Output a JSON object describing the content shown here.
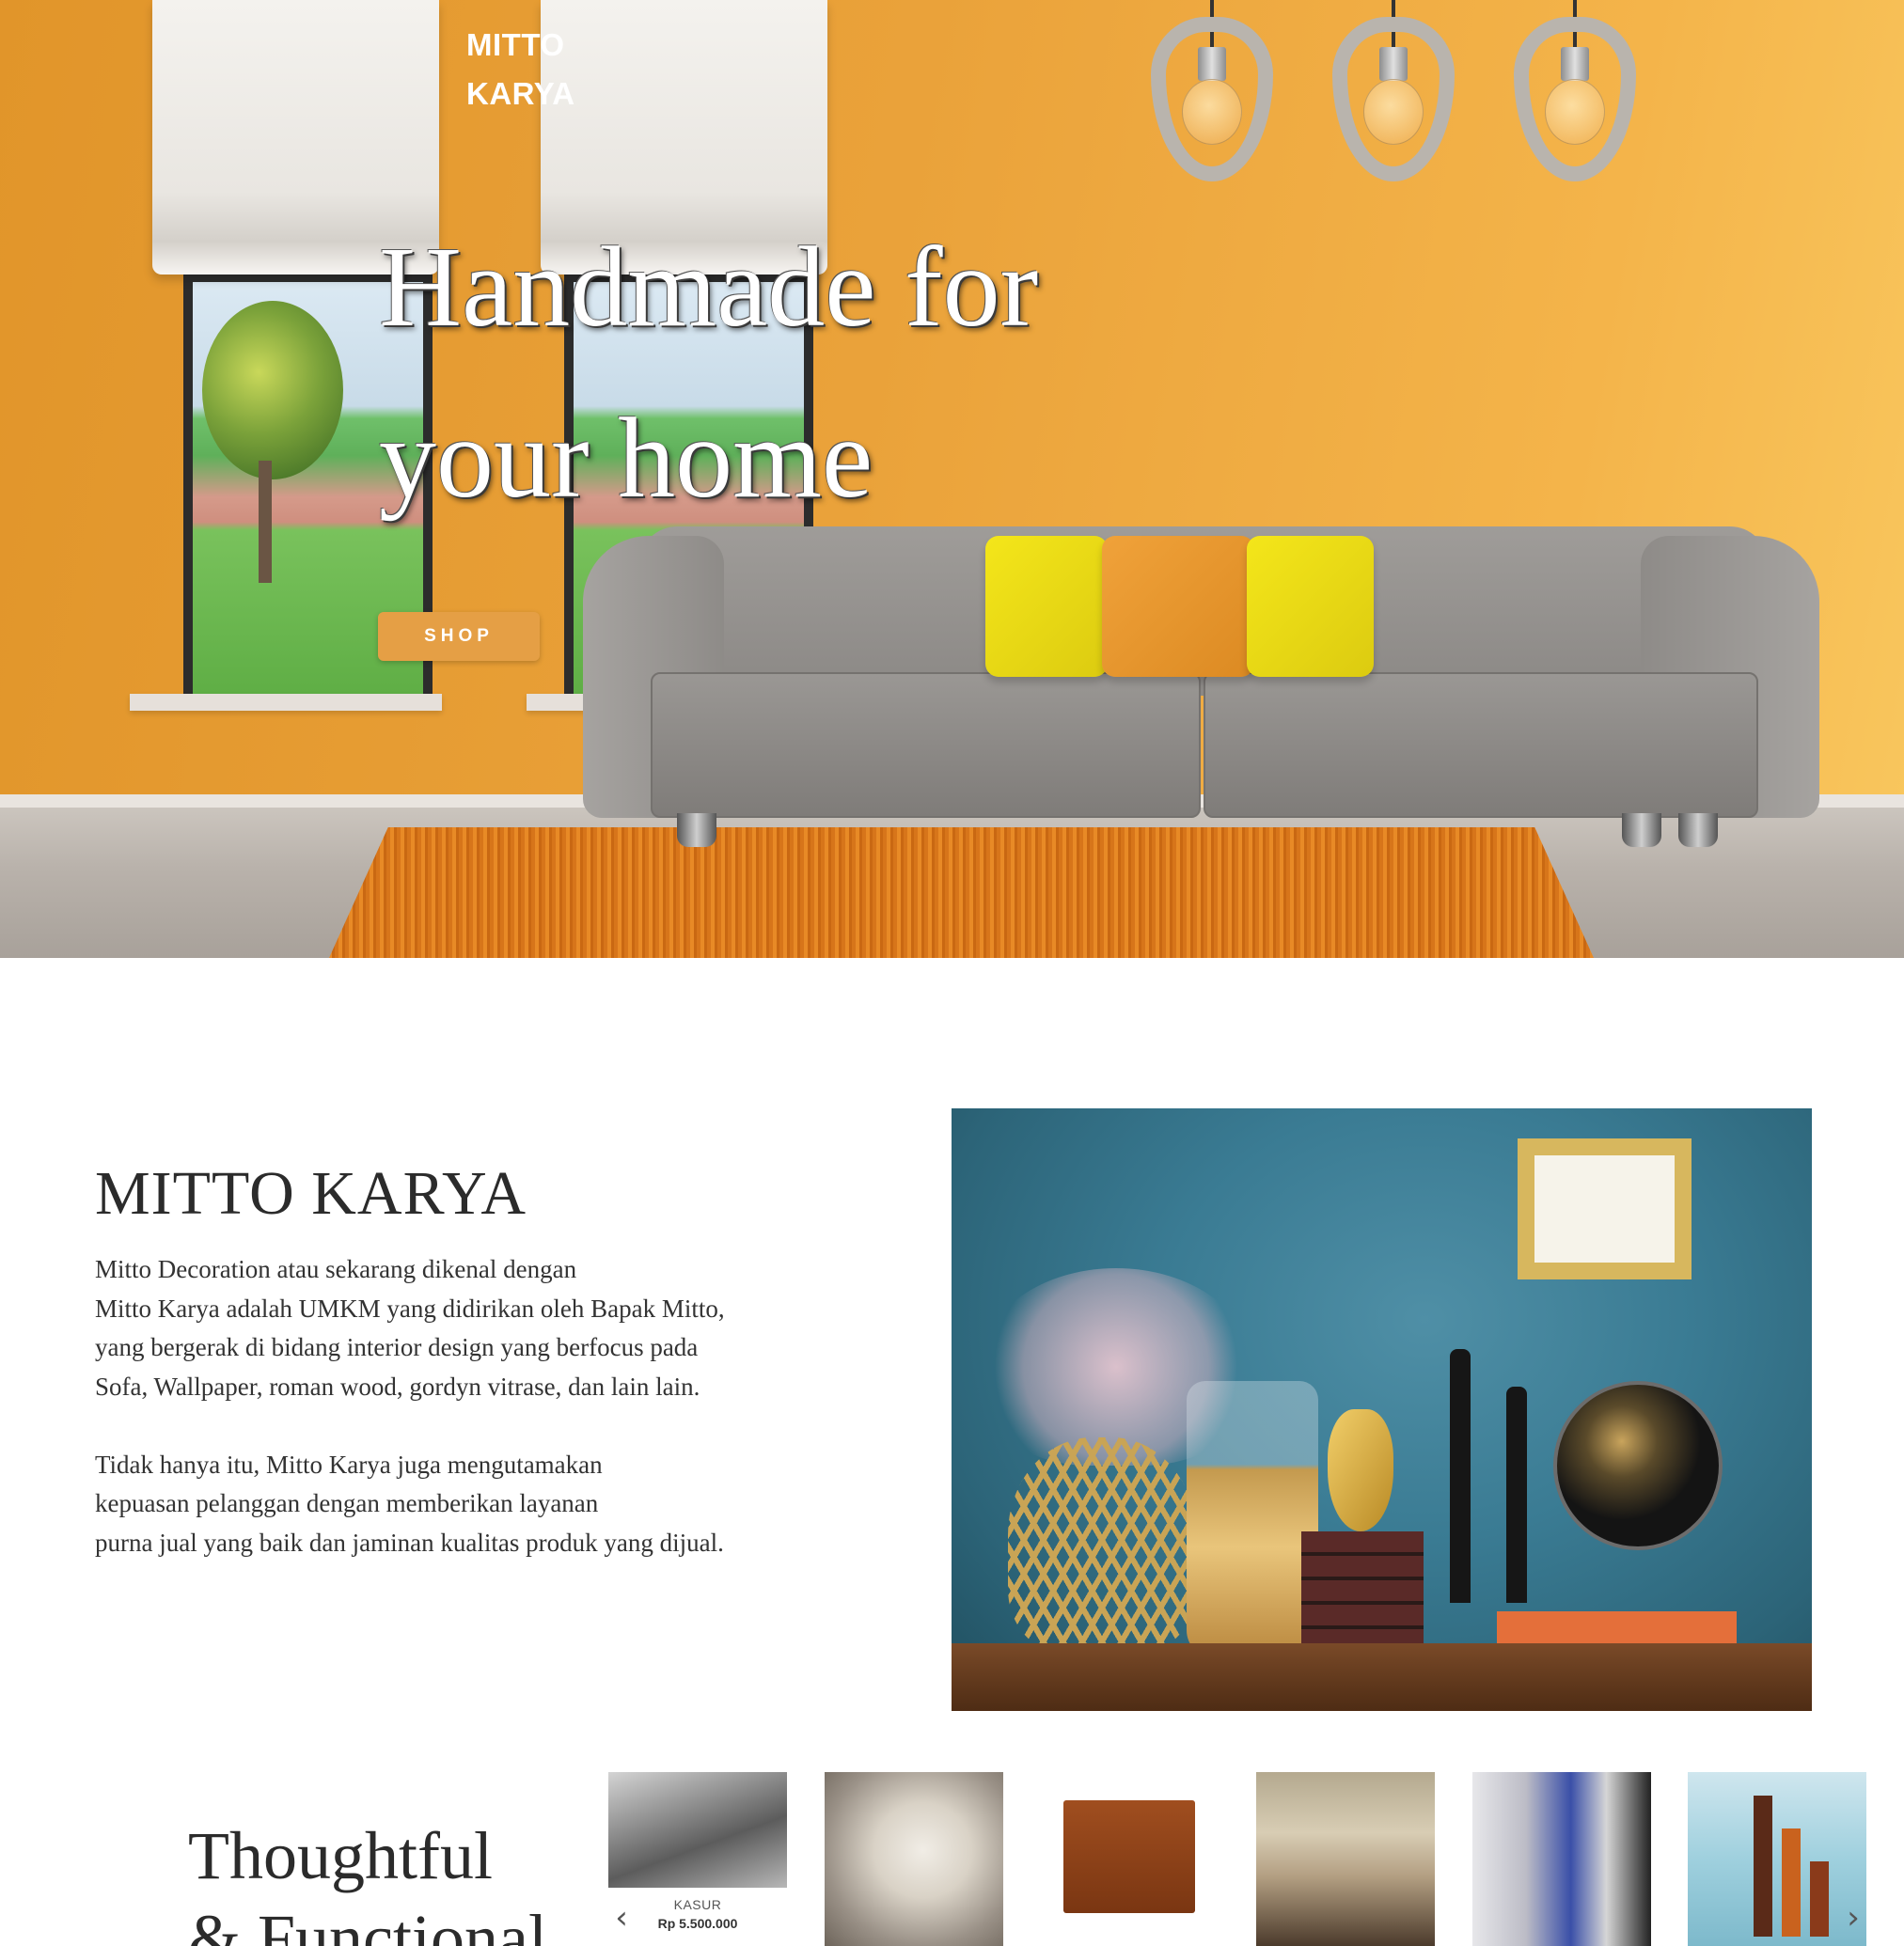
{
  "nav": {
    "brand_line1": "MITTO",
    "brand_line2": "KARYA"
  },
  "hero": {
    "title_line1": "Handmade for",
    "title_line2": "your home",
    "shop_label": "SHOP"
  },
  "about": {
    "title": "MITTO KARYA",
    "paragraph1": [
      "Mitto Decoration atau sekarang dikenal dengan",
      "Mitto Karya adalah UMKM yang didirikan oleh Bapak Mitto,",
      "yang bergerak di bidang interior design yang berfocus pada",
      "Sofa, Wallpaper, roman wood, gordyn vitrase, dan lain lain."
    ],
    "paragraph2": [
      "Tidak hanya itu, Mitto Karya juga mengutamakan",
      "kepuasan pelanggan dengan memberikan layanan",
      "purna jual yang baik dan jaminan kualitas produk yang dijual."
    ]
  },
  "products": {
    "heading_line1": "Thoughtful",
    "heading_line2": "& Functional",
    "prev_icon": "chevron-left-icon",
    "next_icon": "chevron-right-icon",
    "items": [
      {
        "name": "KASUR",
        "price": "Rp 5.500.000"
      },
      {
        "name": "",
        "price": ""
      },
      {
        "name": "",
        "price": ""
      },
      {
        "name": "",
        "price": ""
      },
      {
        "name": "",
        "price": ""
      },
      {
        "name": "",
        "price": ""
      }
    ]
  },
  "colors": {
    "accent": "#e59f45",
    "hero_wall": "#eaa23a",
    "text": "#2b2b2b"
  }
}
